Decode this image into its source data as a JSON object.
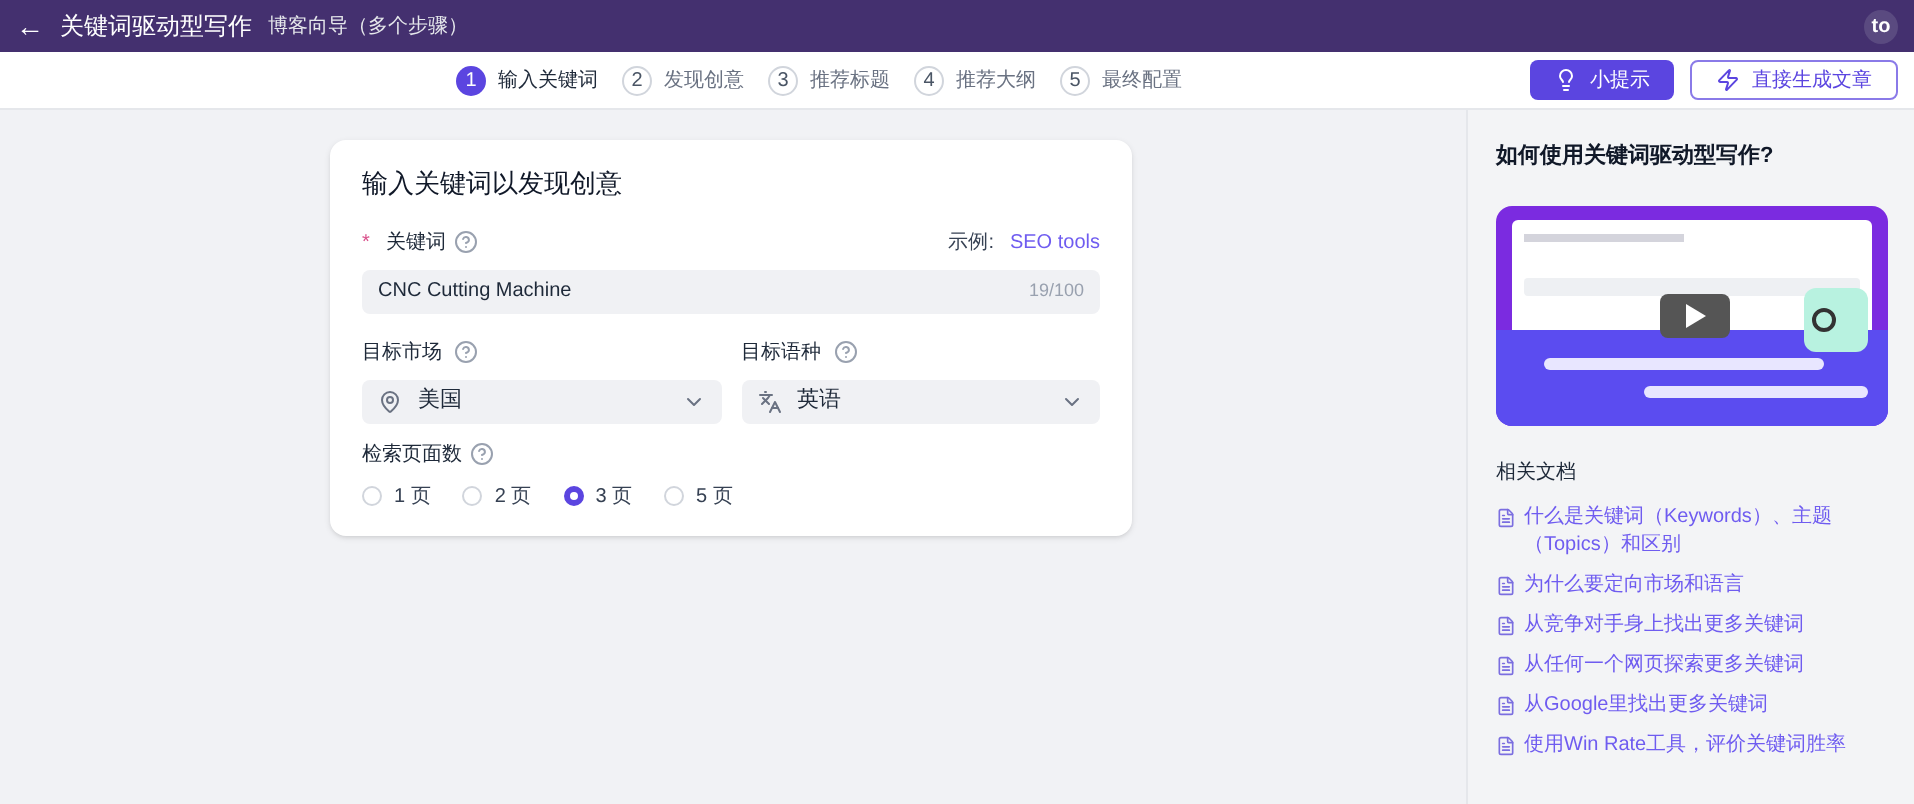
{
  "header": {
    "back": "←",
    "title": "关键词驱动型写作",
    "subtitle": "博客向导（多个步骤）",
    "avatar": "to"
  },
  "steps": [
    {
      "number": "1",
      "label": "输入关键词",
      "selected": true
    },
    {
      "number": "2",
      "label": "发现创意",
      "selected": false
    },
    {
      "number": "3",
      "label": "推荐标题",
      "selected": false
    },
    {
      "number": "4",
      "label": "推荐大纲",
      "selected": false
    },
    {
      "number": "5",
      "label": "最终配置",
      "selected": false
    }
  ],
  "actions": {
    "tips": "小提示",
    "generate": "直接生成文章"
  },
  "form": {
    "title": "输入关键词以发现创意",
    "keyword": {
      "required": "*",
      "label": "关键词",
      "example_label": "示例:",
      "example_link": "SEO tools",
      "value": "CNC Cutting Machine",
      "counter": "19/100"
    },
    "market": {
      "label": "目标市场",
      "value": "美国"
    },
    "language": {
      "label": "目标语种",
      "value": "英语"
    },
    "pages": {
      "label": "检索页面数",
      "options": [
        {
          "label": "1 页",
          "selected": false
        },
        {
          "label": "2 页",
          "selected": false
        },
        {
          "label": "3 页",
          "selected": true
        },
        {
          "label": "5 页",
          "selected": false
        }
      ]
    }
  },
  "sidebar": {
    "title": "如何使用关键词驱动型写作?",
    "docs_title": "相关文档",
    "docs": [
      "什么是关键词（Keywords）、主题（Topics）和区别",
      "为什么要定向市场和语言",
      "从竞争对手身上找出更多关键词",
      "从任何一个网页探索更多关键词",
      "从Google里找出更多关键词",
      "使用Win Rate工具，评价关键词胜率"
    ]
  }
}
